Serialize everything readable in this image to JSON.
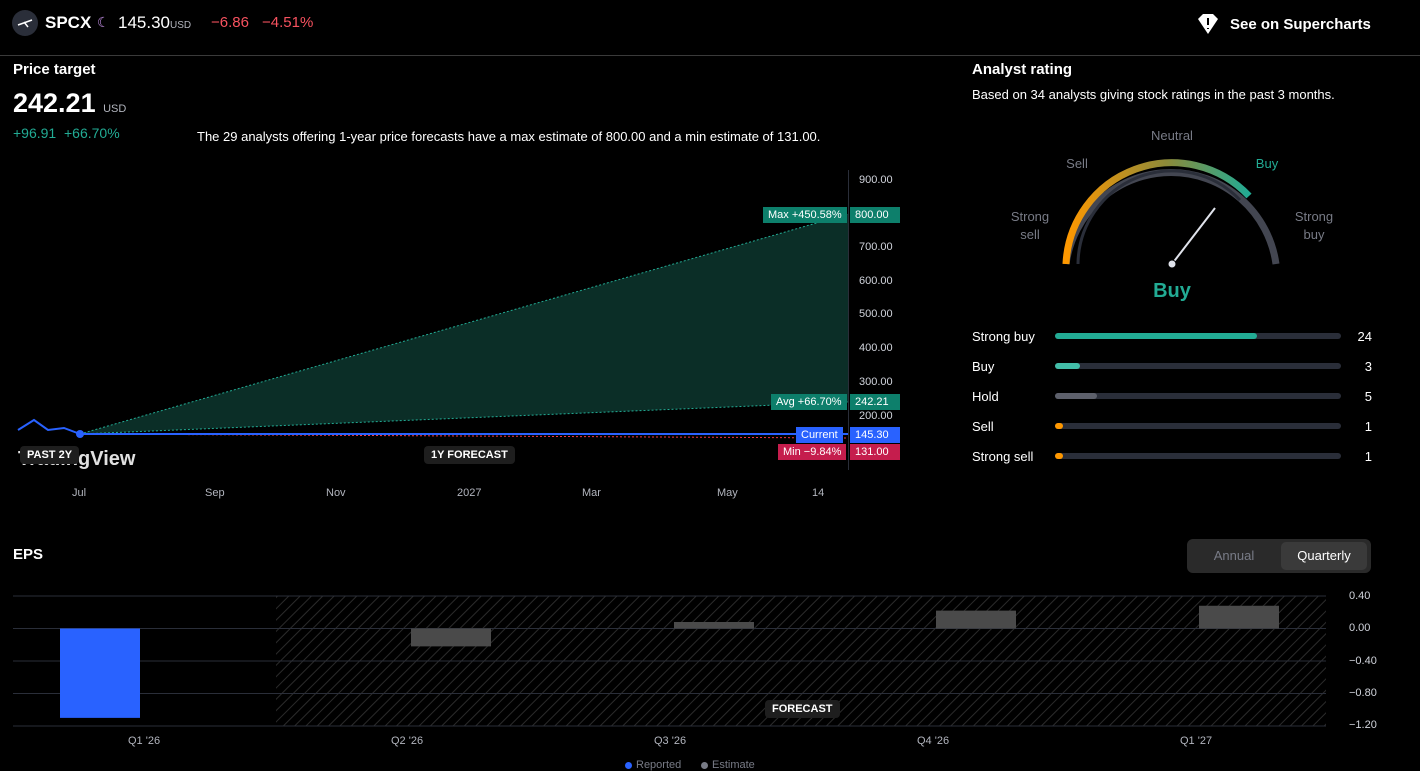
{
  "header": {
    "symbol": "SPCX",
    "price": "145.30",
    "currency": "USD",
    "change": "−6.86",
    "change_pct": "−4.51%",
    "supercharts_label": "See on Supercharts"
  },
  "price_target": {
    "title": "Price target",
    "value": "242.21",
    "currency": "USD",
    "change": "+96.91",
    "change_pct": "+66.70%",
    "description": "The 29 analysts offering 1-year price forecasts have a max estimate of 800.00 and a min estimate of 131.00.",
    "y_ticks": [
      "900.00",
      "700.00",
      "600.00",
      "500.00",
      "400.00",
      "300.00",
      "200.00"
    ],
    "x_ticks": [
      "Jul",
      "Sep",
      "Nov",
      "2027",
      "Mar",
      "May",
      "14"
    ],
    "max_label": "Max +450.58%",
    "max_value": "800.00",
    "avg_label": "Avg +66.70%",
    "avg_value": "242.21",
    "current_label": "Current",
    "current_value": "145.30",
    "min_label": "Min −9.84%",
    "min_value": "131.00",
    "past_label": "PAST 2Y",
    "forecast_label": "1Y FORECAST",
    "watermark": "TradingView",
    "colors": {
      "max": "#089981",
      "avg": "#089981",
      "current": "#2962ff",
      "min": "#f23645",
      "fill": "#0b2e27"
    }
  },
  "analyst_rating": {
    "title": "Analyst rating",
    "subtitle": "Based on 34 analysts giving stock ratings in the past 3 months.",
    "gauge_labels": {
      "strong_sell": "Strong\nsell",
      "sell": "Sell",
      "neutral": "Neutral",
      "buy": "Buy",
      "strong_buy": "Strong\nbuy"
    },
    "verdict": "Buy",
    "rows": [
      {
        "label": "Strong buy",
        "count": "24",
        "fraction": 0.706,
        "color": "#22ab94"
      },
      {
        "label": "Buy",
        "count": "3",
        "fraction": 0.088,
        "color": "#42bda8"
      },
      {
        "label": "Hold",
        "count": "5",
        "fraction": 0.147,
        "color": "#5d606b"
      },
      {
        "label": "Sell",
        "count": "1",
        "fraction": 0.029,
        "color": "#ff9800"
      },
      {
        "label": "Strong sell",
        "count": "1",
        "fraction": 0.029,
        "color": "#ff9800"
      }
    ]
  },
  "eps": {
    "title": "EPS",
    "toggle": {
      "annual": "Annual",
      "quarterly": "Quarterly",
      "selected": "Quarterly"
    },
    "forecast_label": "FORECAST",
    "legend": {
      "reported": "Reported",
      "estimate": "Estimate"
    }
  },
  "chart_data": {
    "type": "bar",
    "categories": [
      "Q1 '26",
      "Q2 '26",
      "Q3 '26",
      "Q4 '26",
      "Q1 '27"
    ],
    "series": [
      {
        "name": "Reported",
        "values": [
          -1.1,
          null,
          null,
          null,
          null
        ]
      },
      {
        "name": "Estimate",
        "values": [
          null,
          -0.22,
          0.08,
          0.22,
          0.28
        ]
      }
    ],
    "y_ticks": [
      "0.40",
      "0.00",
      "−0.40",
      "−0.80",
      "−1.20"
    ],
    "ylim": [
      -1.2,
      0.4
    ],
    "grid": true,
    "legend_position": "bottom"
  }
}
